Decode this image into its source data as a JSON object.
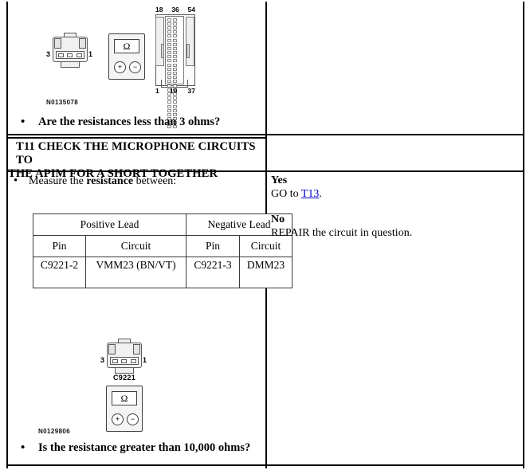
{
  "step_top": {
    "figure_number": "N0135078",
    "connector_small": {
      "pin_left": "3",
      "pin_right": "1"
    },
    "meter": {
      "display": "Ω",
      "button_plus": "+",
      "button_minus": "−"
    },
    "connector_large": {
      "top_labels": [
        "18",
        "36",
        "54"
      ],
      "bottom_labels": [
        "1",
        "19",
        "37"
      ]
    },
    "question": "Are the resistances less than 3 ohms?"
  },
  "step": {
    "id": "T11",
    "header_line1": "T11 CHECK THE MICROPHONE CIRCUITS TO",
    "header_line2": "THE APIM FOR A SHORT TOGETHER",
    "instruction_prefix": "Measure the ",
    "instruction_bold": "resistance",
    "instruction_suffix": " between:",
    "question": "Is the resistance greater than 10,000 ohms?",
    "figure_number": "N0129806",
    "connector_name": "C9221",
    "connector_pin_left": "3",
    "connector_pin_right": "1",
    "meter": {
      "display": "Ω",
      "button_plus": "+",
      "button_minus": "−"
    }
  },
  "pin_table": {
    "group_headers": [
      "Positive Lead",
      "Negative Lead"
    ],
    "column_headers": [
      "Pin",
      "Circuit",
      "Pin",
      "Circuit"
    ],
    "rows": [
      {
        "pos_pin": "C9221-2",
        "pos_circuit": "VMM23 (BN/VT)",
        "neg_pin": "C9221-3",
        "neg_circuit": "DMM23"
      }
    ]
  },
  "answers": {
    "yes_label": "Yes",
    "yes_action_prefix": "GO to ",
    "yes_link": "T13",
    "yes_action_suffix": ".",
    "no_label": "No",
    "no_action": "REPAIR the circuit in question."
  },
  "colors": {
    "link": "#0000cc",
    "text": "#000000",
    "rule": "#000000",
    "diagram_stroke": "#58585a"
  }
}
